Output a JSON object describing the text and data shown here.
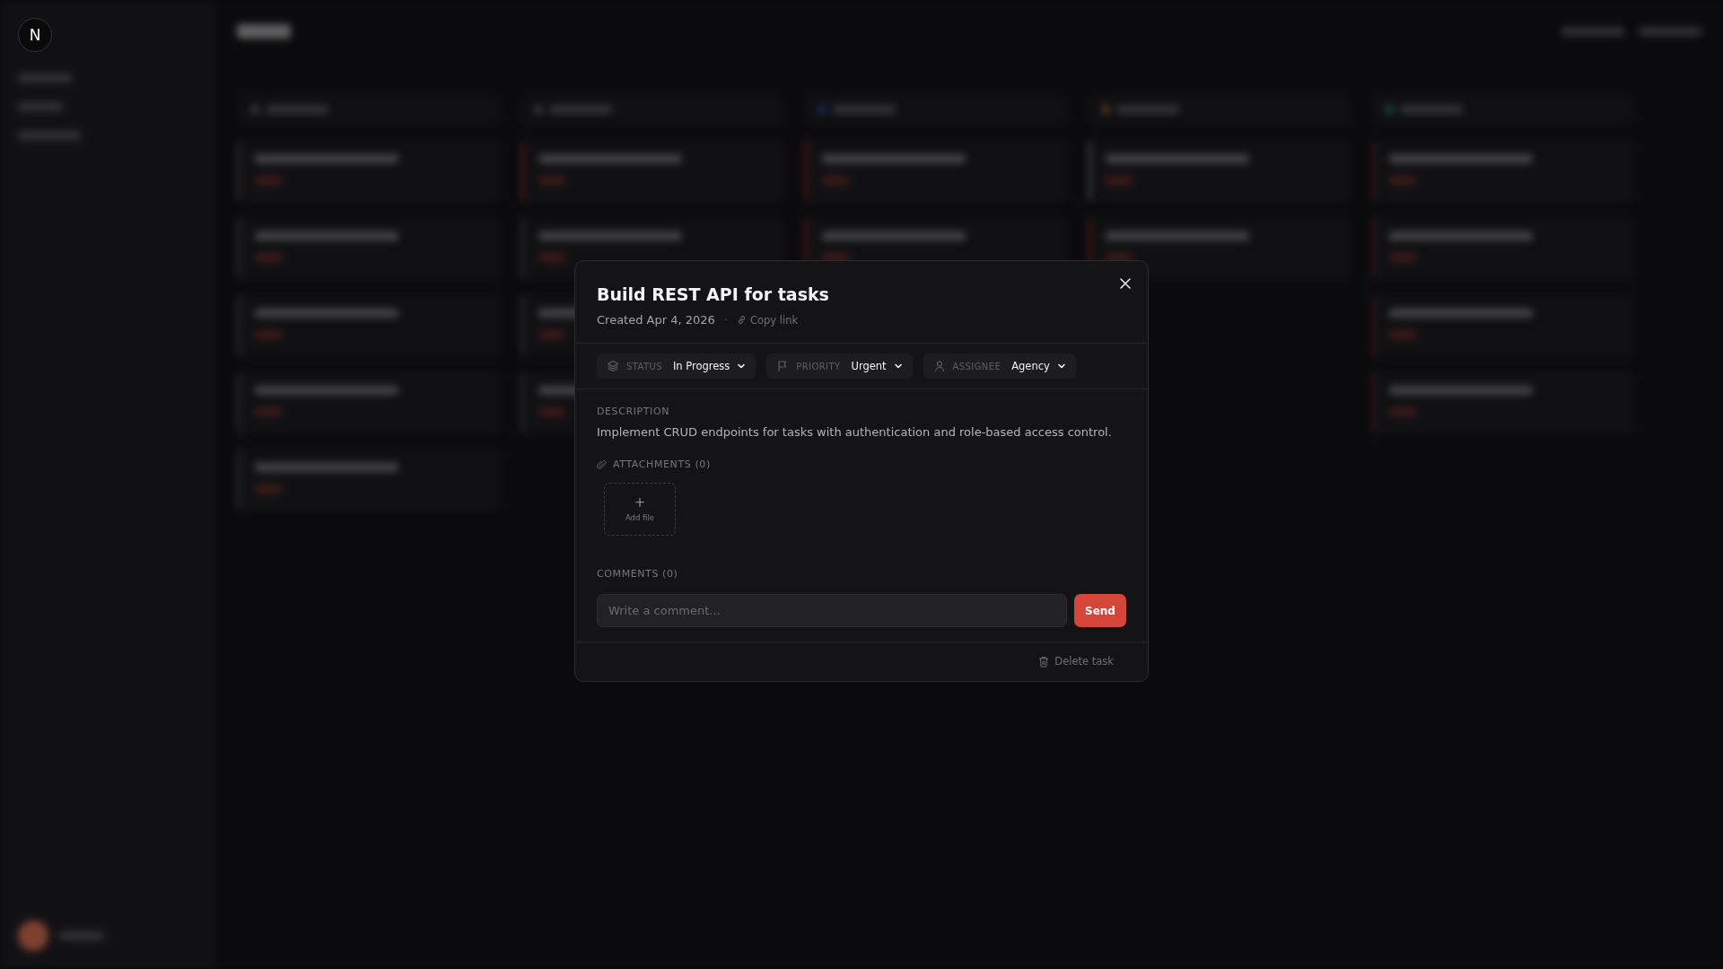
{
  "sidebar": {
    "logo_letter": "N"
  },
  "modal": {
    "title": "Build REST API for tasks",
    "created": "Created Apr 4, 2026",
    "separator": "·",
    "copy_link": "Copy link",
    "fields": [
      {
        "kind": "status",
        "label": "STATUS",
        "value": "In Progress"
      },
      {
        "kind": "priority",
        "label": "PRIORITY",
        "value": "Urgent"
      },
      {
        "kind": "assignee",
        "label": "ASSIGNEE",
        "value": "Agency"
      }
    ],
    "description": {
      "label": "DESCRIPTION",
      "text": "Implement CRUD endpoints for tasks with authentication and role-based access control."
    },
    "attachments": {
      "label": "ATTACHMENTS (0)",
      "add_icon": "+",
      "add_label": "Add file"
    },
    "comments": {
      "label": "COMMENTS (0)",
      "placeholder": "Write a comment...",
      "send": "Send"
    },
    "delete_label": "Delete task"
  }
}
